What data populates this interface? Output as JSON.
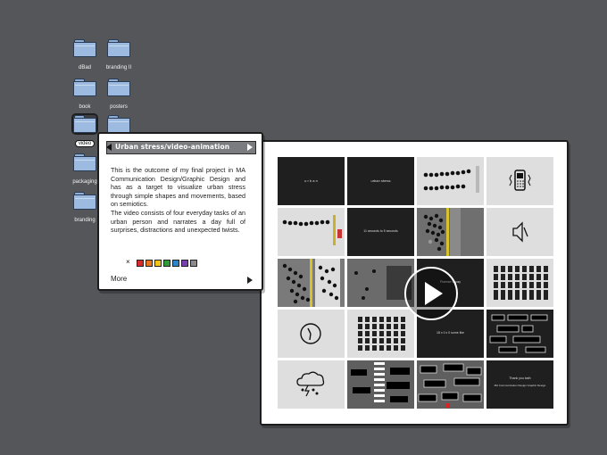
{
  "desktop": {
    "folders": [
      {
        "label": "dBad"
      },
      {
        "label": "branding II"
      },
      {
        "label": "book"
      },
      {
        "label": "posters"
      },
      {
        "label": "video"
      },
      {
        "label": "packaging"
      },
      {
        "label": "branding"
      }
    ]
  },
  "info_panel": {
    "title": "Urban stress/video-animation",
    "paragraph1": "This is the outcome of my final project in MA Communication Design/Graphic Design and has as a target to visualize urban stress through simple shapes and movements, based on semiotics.",
    "paragraph2": "The video consists of four everyday tasks of an urban person and narrates a day full of surprises, distractions and unexpected twists.",
    "close_symbol": "×",
    "swatch_colors": [
      "#d92b2b",
      "#e8741c",
      "#f2c318",
      "#2e9a3a",
      "#2d86c9",
      "#7a3fb0",
      "#8c8c8c"
    ],
    "more_label": "More"
  },
  "video": {
    "thumb_texts": {
      "t0": "u  r  b  a  n",
      "t1": "urban stress",
      "t5": "11 seconds to 5 seconds",
      "t10": "Fluence to pay",
      "t14": "18 x 0 x 0 some like",
      "t19": "Thank you bath",
      "t19b": "MA Communication Design\nGraphic Design"
    },
    "play_icon": "play-icon"
  }
}
